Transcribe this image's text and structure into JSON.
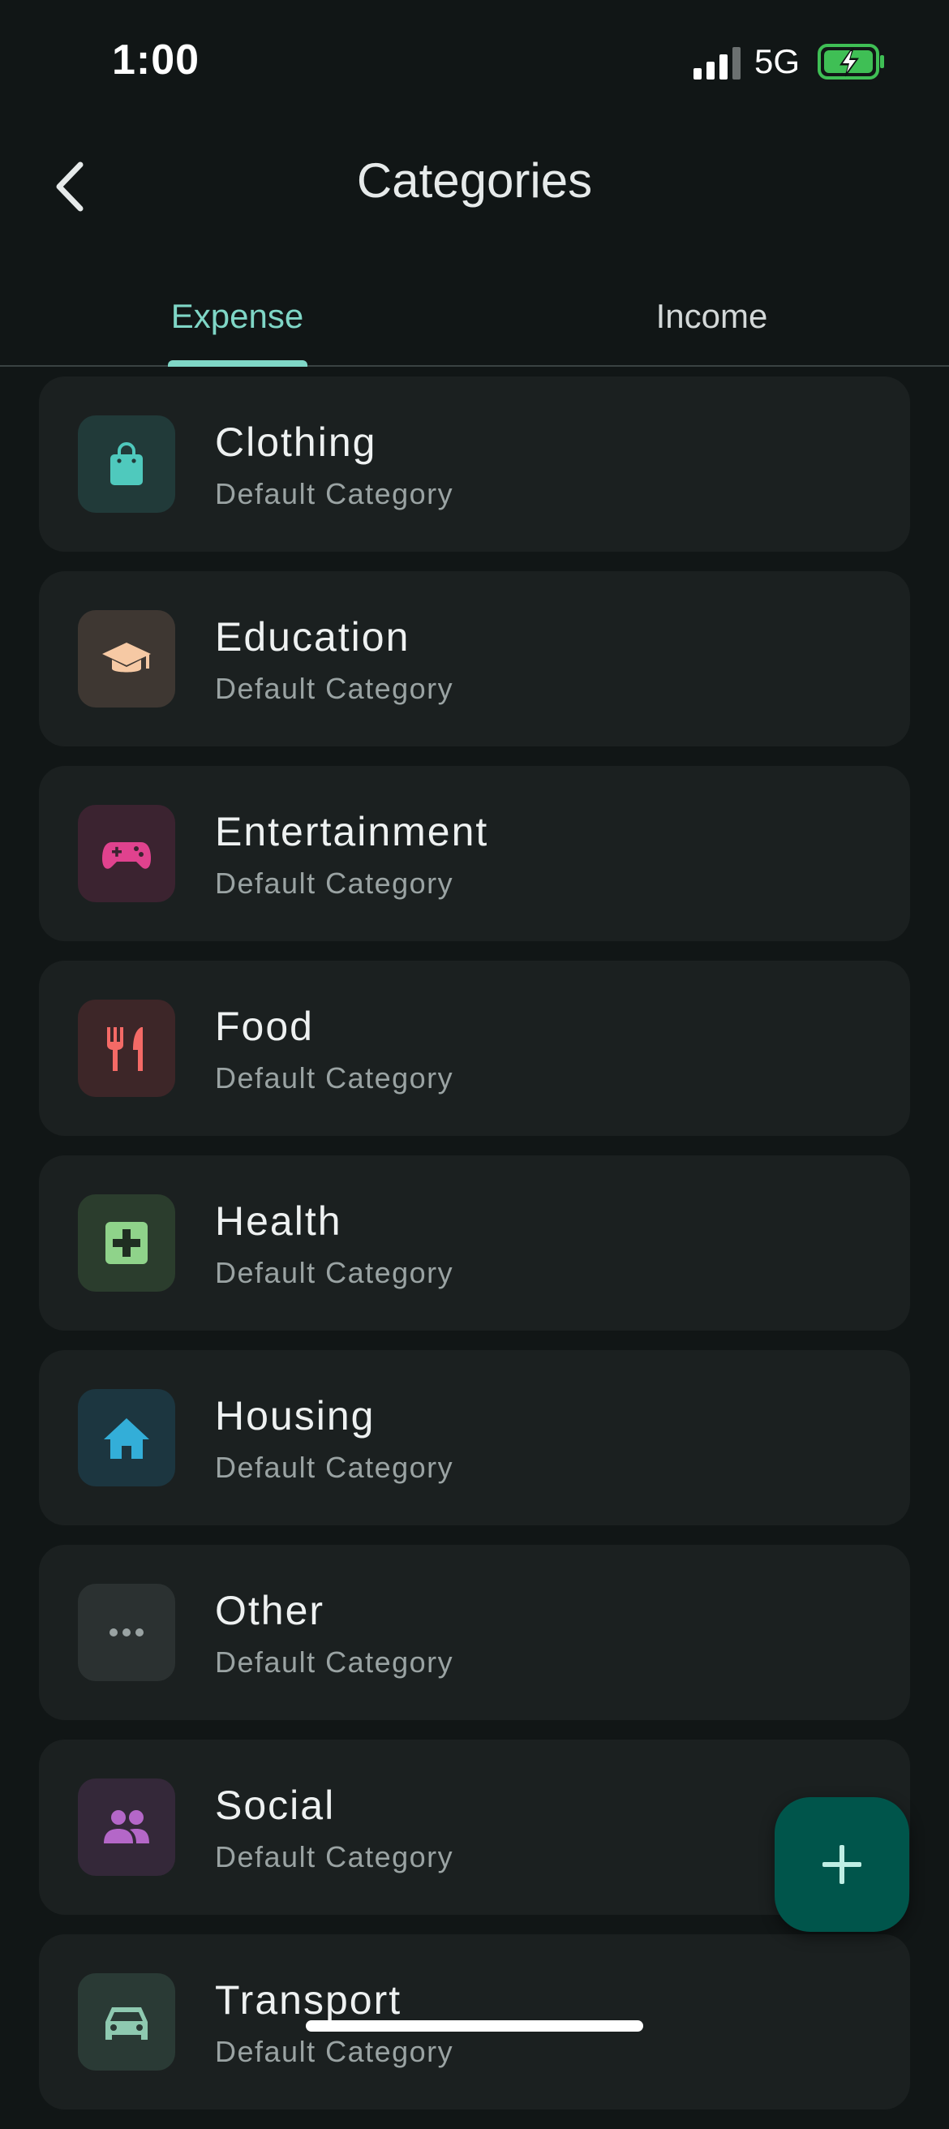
{
  "status_bar": {
    "time": "1:00",
    "network": "5G",
    "signal_icon": "cellular-signal-icon",
    "battery_icon": "battery-charging-icon"
  },
  "header": {
    "title": "Categories",
    "back_icon": "chevron-left-icon"
  },
  "tabs": {
    "items": [
      {
        "label": "Expense",
        "active": true
      },
      {
        "label": "Income",
        "active": false
      }
    ],
    "accent": "#7fd6c6"
  },
  "categories": [
    {
      "name": "Clothing",
      "subtitle": "Default Category",
      "icon": "shopping-bag-icon",
      "color": "#4fc9bd",
      "bg": "#213a39"
    },
    {
      "name": "Education",
      "subtitle": "Default Category",
      "icon": "graduation-cap-icon",
      "color": "#f6c9a4",
      "bg": "#3e3732"
    },
    {
      "name": "Entertainment",
      "subtitle": "Default Category",
      "icon": "gamepad-icon",
      "color": "#e0428e",
      "bg": "#3b2330"
    },
    {
      "name": "Food",
      "subtitle": "Default Category",
      "icon": "fork-knife-icon",
      "color": "#f46a66",
      "bg": "#3d2628"
    },
    {
      "name": "Health",
      "subtitle": "Default Category",
      "icon": "medical-cross-icon",
      "color": "#8fd38a",
      "bg": "#2b3d2d"
    },
    {
      "name": "Housing",
      "subtitle": "Default Category",
      "icon": "home-icon",
      "color": "#33aed8",
      "bg": "#1c3640"
    },
    {
      "name": "Other",
      "subtitle": "Default Category",
      "icon": "more-horizontal-icon",
      "color": "#9aa3a3",
      "bg": "#2b3131"
    },
    {
      "name": "Social",
      "subtitle": "Default Category",
      "icon": "people-icon",
      "color": "#b467c8",
      "bg": "#342839"
    },
    {
      "name": "Transport",
      "subtitle": "Default Category",
      "icon": "car-icon",
      "color": "#8ec9b0",
      "bg": "#2a3a35"
    }
  ],
  "fab": {
    "icon": "plus-icon",
    "color": "#00554b"
  }
}
